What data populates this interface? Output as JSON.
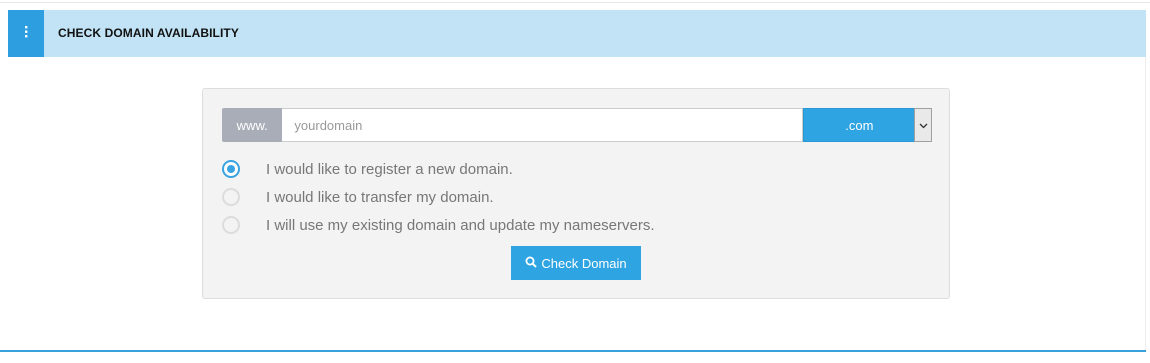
{
  "header": {
    "title": "CHECK DOMAIN AVAILABILITY",
    "icon": "vertical-dots-icon"
  },
  "domain_search": {
    "prefix": "www.",
    "placeholder": "yourdomain",
    "value": "",
    "tld_selected": ".com",
    "options": [
      {
        "label": "I would like to register a new domain.",
        "checked": true
      },
      {
        "label": "I would like to transfer my domain.",
        "checked": false
      },
      {
        "label": "I will use my existing domain and update my nameservers.",
        "checked": false
      }
    ],
    "button_label": "Check Domain",
    "button_icon": "search-icon"
  },
  "colors": {
    "header_bg": "#c1e3f5",
    "accent": "#2fa4e3",
    "prefix_bg": "#a8adb8"
  }
}
